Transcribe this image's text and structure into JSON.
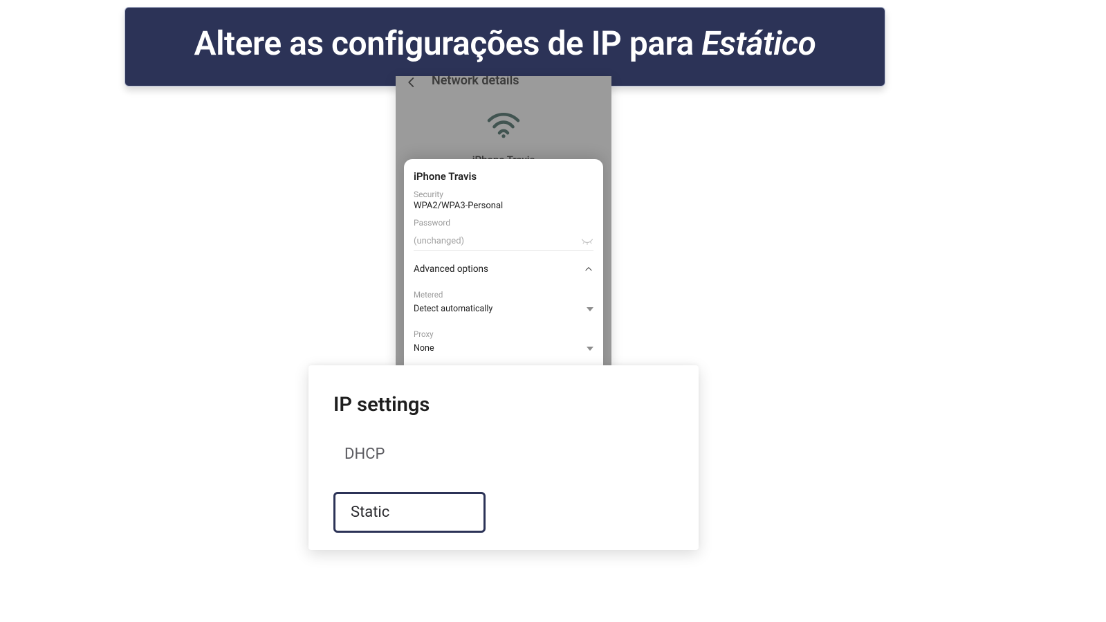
{
  "banner": {
    "text_before_em": "Altere as configurações de IP para ",
    "em": "Estático"
  },
  "phone": {
    "header_title": "Network details",
    "ssid": "iPhone Travis"
  },
  "sheet": {
    "title": "iPhone Travis",
    "security_label": "Security",
    "security_value": "WPA2/WPA3-Personal",
    "password_label": "Password",
    "password_placeholder": "(unchanged)",
    "advanced_label": "Advanced options",
    "metered_label": "Metered",
    "metered_value": "Detect automatically",
    "proxy_label": "Proxy",
    "proxy_value": "None"
  },
  "ip_card": {
    "title": "IP settings",
    "option_dhcp": "DHCP",
    "option_static": "Static"
  }
}
